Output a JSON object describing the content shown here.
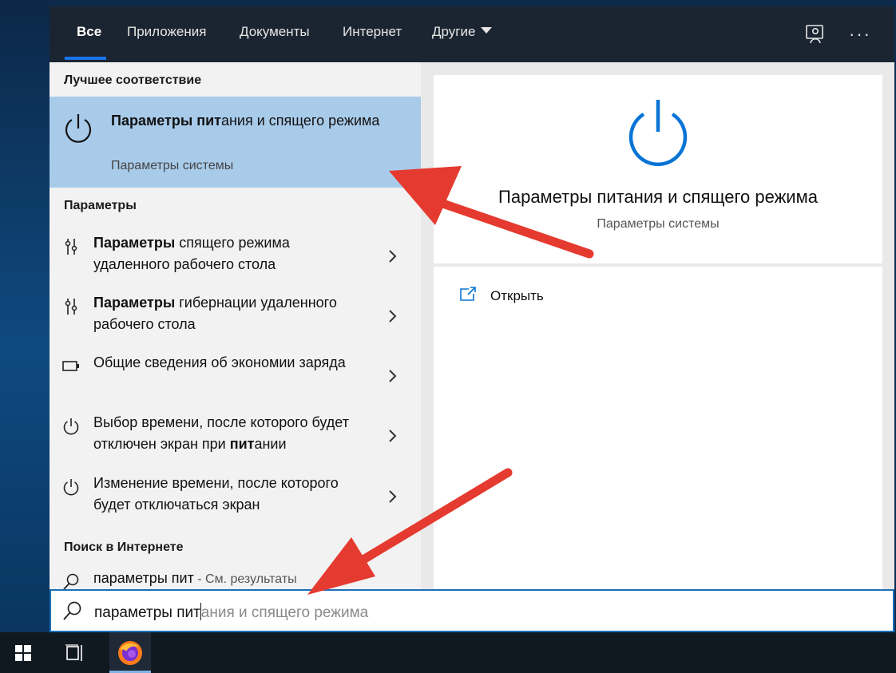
{
  "tabs": [
    {
      "label": "Все",
      "active": true
    },
    {
      "label": "Приложения",
      "active": false
    },
    {
      "label": "Документы",
      "active": false
    },
    {
      "label": "Интернет",
      "active": false
    },
    {
      "label": "Другие",
      "active": false
    }
  ],
  "topbar_icons": [
    "feedback-icon",
    "more-options-icon"
  ],
  "more_label": "···",
  "sections": {
    "best_match": "Лучшее соответствие",
    "settings": "Параметры",
    "web": "Поиск в Интернете"
  },
  "best_match": {
    "title_bold": "Параметры пит",
    "title_rest": "ания и спящего режима",
    "subtitle": "Параметры системы",
    "icon": "power-icon"
  },
  "settings_items": [
    {
      "bold": "Параметры",
      "rest": " спящего режима удаленного рабочего стола",
      "icon": "settings-sliders-icon"
    },
    {
      "bold": "Параметры",
      "rest": " гибернации удаленного рабочего стола",
      "icon": "settings-sliders-icon"
    },
    {
      "pre": "Общие сведения об экономии заряда",
      "icon": "battery-icon"
    },
    {
      "pre": "Выбор времени, после которого будет отключен экран при ",
      "bold": "пит",
      "rest": "ании",
      "icon": "power-icon"
    },
    {
      "pre": "Изменение времени, после которого будет отключаться экран",
      "icon": "power-icon"
    }
  ],
  "web_item": {
    "query": "параметры пит",
    "suffix": " - См. результаты",
    "icon": "search-icon"
  },
  "preview": {
    "title": "Параметры питания и спящего режима",
    "subtitle": "Параметры системы",
    "action_label": "Открыть",
    "accent": "#0a74d6"
  },
  "search": {
    "typed": "параметры пит",
    "suggestion": "ания и спящего режима"
  },
  "taskbar": [
    "windows-start-icon",
    "task-view-icon",
    "firefox-icon"
  ],
  "annotation_color": "#e53a2f"
}
